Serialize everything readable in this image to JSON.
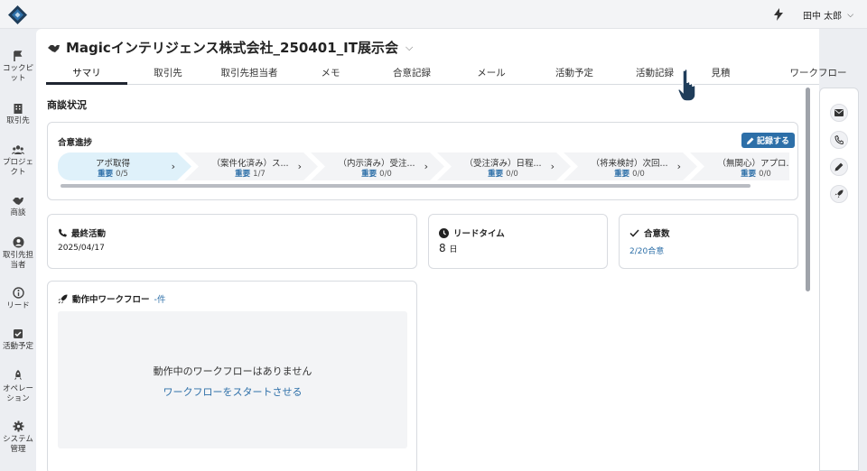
{
  "header": {
    "user_name": "田中 太郎"
  },
  "sidebar": {
    "items": [
      {
        "label": "コックピット",
        "icon": "flag-icon"
      },
      {
        "label": "取引先",
        "icon": "building-icon"
      },
      {
        "label": "プロジェクト",
        "icon": "team-icon"
      },
      {
        "label": "商談",
        "icon": "handshake-icon"
      },
      {
        "label": "取引先担当者",
        "icon": "contact-icon"
      },
      {
        "label": "リード",
        "icon": "lead-icon"
      },
      {
        "label": "活動予定",
        "icon": "task-icon"
      },
      {
        "label": "オペレーション",
        "icon": "rocket-icon"
      },
      {
        "label": "システム管理",
        "icon": "gear-icon"
      }
    ]
  },
  "deal": {
    "title": "Magicインテリジェンス株式会社_250401_IT展示会"
  },
  "tabs": [
    "サマリ",
    "取引先",
    "取引先担当者",
    "メモ",
    "合意記録",
    "メール",
    "活動予定",
    "活動記録",
    "見積",
    "ワークフロー"
  ],
  "summary": {
    "section_title": "商談状況",
    "progress": {
      "title": "合意進捗",
      "record_button": "記録する",
      "important_label": "重要",
      "stages": [
        {
          "name": "アポ取得",
          "count": "0/5"
        },
        {
          "name": "（案件化済み）ス...",
          "count": "1/7"
        },
        {
          "name": "（内示済み）受注...",
          "count": "0/0"
        },
        {
          "name": "（受注済み）日程...",
          "count": "0/0"
        },
        {
          "name": "（将来検討）次回...",
          "count": "0/0"
        },
        {
          "name": "（無関心）アプロ...",
          "count": "0/0"
        }
      ]
    },
    "last_activity": {
      "title": "最終活動",
      "value": "2025/04/17"
    },
    "lead_time": {
      "title": "リードタイム",
      "value": "8",
      "unit": "日"
    },
    "agreements": {
      "title": "合意数",
      "value": "2/20合意"
    },
    "workflow": {
      "title": "動作中ワークフロー",
      "count": "-件",
      "empty_message": "動作中のワークフローはありません",
      "start_link": "ワークフローをスタートさせる"
    }
  },
  "right_rail": [
    "mail-icon",
    "phone-icon",
    "pencil-icon",
    "rocket-icon"
  ],
  "colors": {
    "accent": "#2d6fa8",
    "active_stage": "#dff1fa",
    "panel_bg": "#ffffff",
    "app_bg": "#eceef2"
  }
}
